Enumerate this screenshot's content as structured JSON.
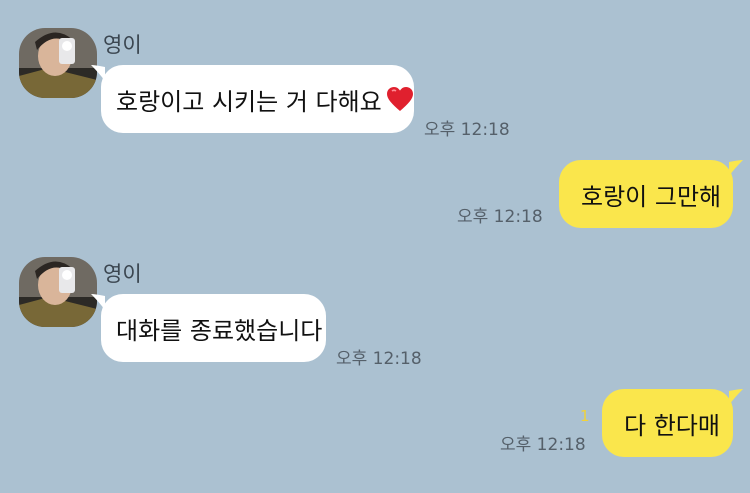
{
  "chat": {
    "background_color": "#abc1d1",
    "incoming_bubble_color": "#ffffff",
    "outgoing_bubble_color": "#fae64c",
    "messages": [
      {
        "direction": "incoming",
        "sender": "영이",
        "avatar": "profile-photo",
        "text": "호랑이고 시키는 거 다해요",
        "emoji": "❤️",
        "time": "오후 12:18"
      },
      {
        "direction": "outgoing",
        "text": "호랑이 그만해",
        "time": "오후 12:18"
      },
      {
        "direction": "incoming",
        "sender": "영이",
        "avatar": "profile-photo",
        "text": "대화를 종료했습니다",
        "time": "오후 12:18"
      },
      {
        "direction": "outgoing",
        "text": "다 한다매",
        "unread_count": "1",
        "time": "오후 12:18"
      }
    ]
  }
}
